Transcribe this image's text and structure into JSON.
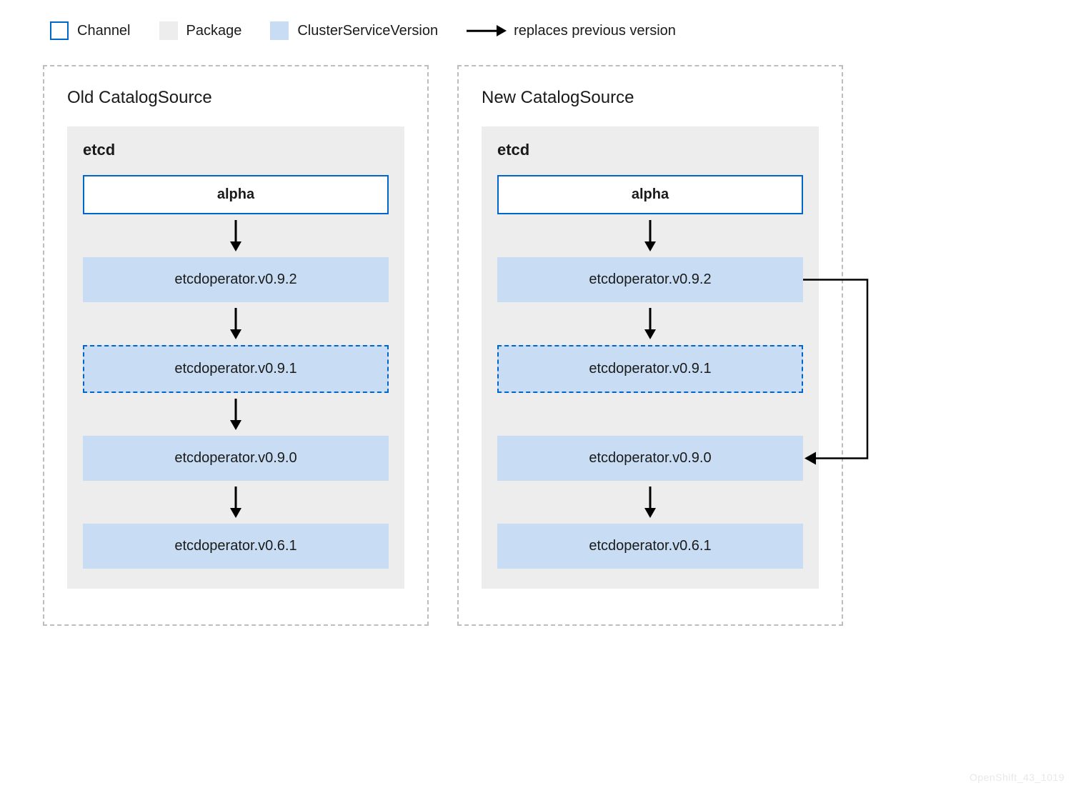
{
  "legend": {
    "channel": "Channel",
    "package": "Package",
    "csv": "ClusterServiceVersion",
    "replaces": "replaces previous version"
  },
  "catalogs": [
    {
      "title": "Old CatalogSource",
      "package": {
        "name": "etcd",
        "channel": "alpha",
        "versions": [
          {
            "label": "etcdoperator.v0.9.2",
            "dashed": false
          },
          {
            "label": "etcdoperator.v0.9.1",
            "dashed": true
          },
          {
            "label": "etcdoperator.v0.9.0",
            "dashed": false
          },
          {
            "label": "etcdoperator.v0.6.1",
            "dashed": false
          }
        ]
      }
    },
    {
      "title": "New CatalogSource",
      "package": {
        "name": "etcd",
        "channel": "alpha",
        "versions": [
          {
            "label": "etcdoperator.v0.9.2",
            "dashed": false
          },
          {
            "label": "etcdoperator.v0.9.1",
            "dashed": true
          },
          {
            "label": "etcdoperator.v0.9.0",
            "dashed": false
          },
          {
            "label": "etcdoperator.v0.6.1",
            "dashed": false
          }
        ],
        "skip_arrows": [
          {
            "from": "etcdoperator.v0.9.2",
            "to": "etcdoperator.v0.9.0"
          }
        ],
        "hide_arrow_after": [
          "etcdoperator.v0.9.1"
        ]
      }
    }
  ],
  "attribution": "OpenShift_43_1019"
}
